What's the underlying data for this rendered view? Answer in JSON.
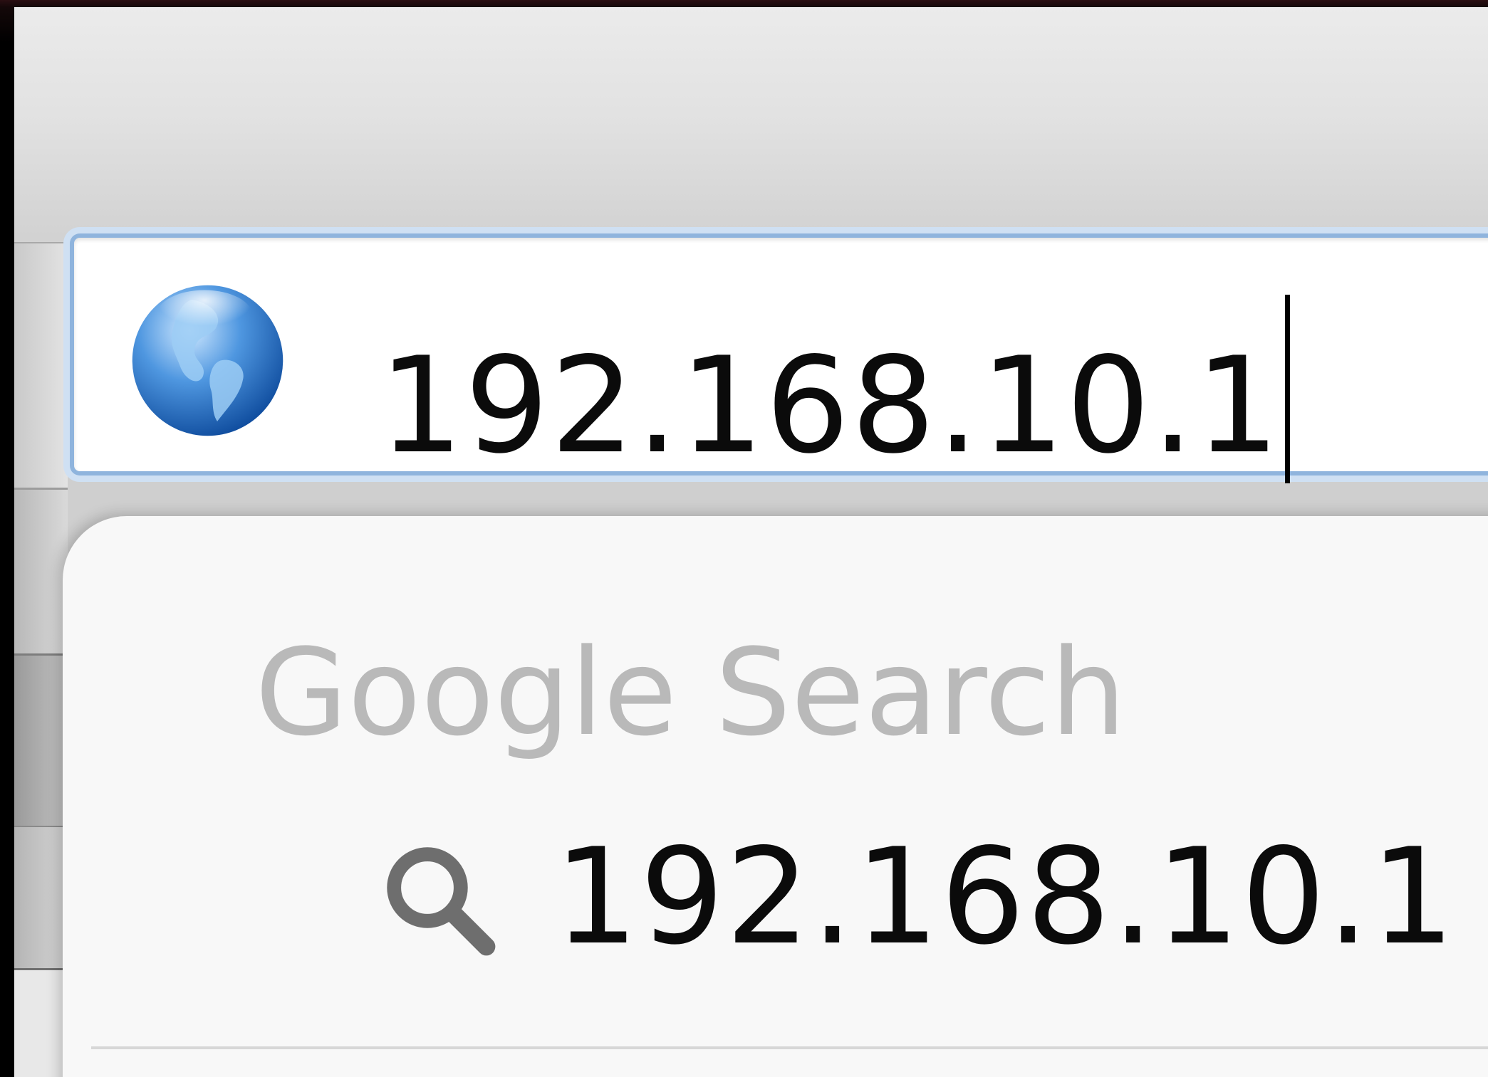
{
  "address_bar": {
    "url": "192.168.10.1",
    "icon": "globe-icon"
  },
  "popup": {
    "section_header": "Google Search",
    "suggestions": [
      {
        "icon": "search-icon",
        "text": "192.168.10.1"
      }
    ]
  },
  "colors": {
    "focus_ring": "#8fb4dd",
    "text": "#0b0b0b",
    "header_text": "#b9b9b9",
    "popup_background": "#f8f8f8"
  }
}
